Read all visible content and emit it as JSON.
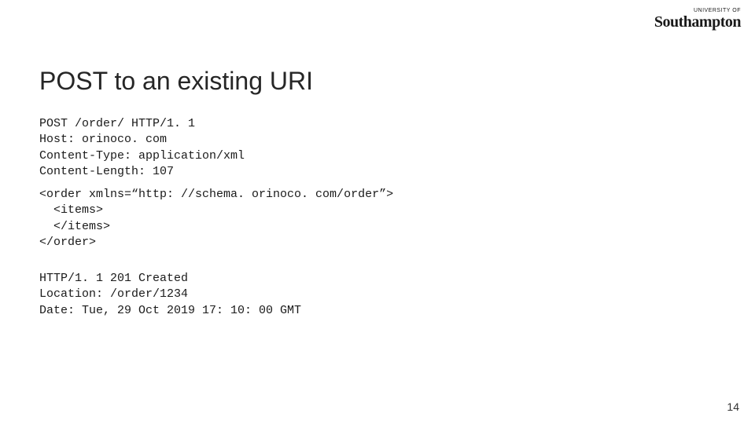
{
  "logo": {
    "overline": "UNIVERSITY OF",
    "bold": "Southampton",
    "rest": ""
  },
  "title": "POST to an existing URI",
  "blocks": {
    "request_headers": "POST /order/ HTTP/1. 1\nHost: orinoco. com\nContent-Type: application/xml\nContent-Length: 107",
    "request_body": "<order xmlns=“http: //schema. orinoco. com/order”>\n  <items>\n  </items>\n</order>",
    "response": "HTTP/1. 1 201 Created\nLocation: /order/1234\nDate: Tue, 29 Oct 2019 17: 10: 00 GMT"
  },
  "page_number": "14"
}
